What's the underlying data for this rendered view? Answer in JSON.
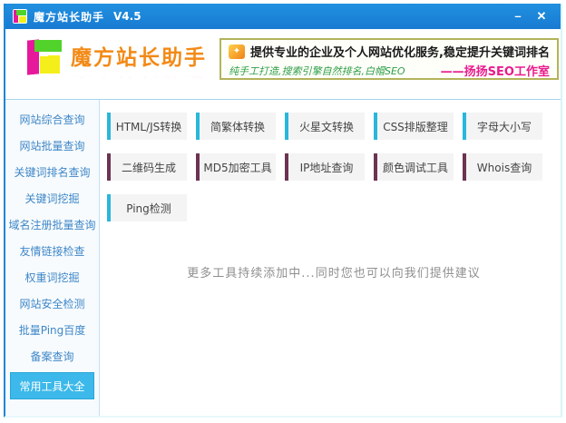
{
  "window": {
    "title": "魔方站长助手",
    "version": "V4.5",
    "minimize_label": "–",
    "close_label": "✕"
  },
  "header": {
    "logo_text": "魔方站长助手",
    "banner": {
      "icon": "seo-ad-icon",
      "line1": "提供专业的企业及个人网站优化服务,稳定提升关键词排名",
      "line2_left": "纯手工打造,搜索引擎自然排名,白帽SEO",
      "line2_right": "——扬扬SEO工作室"
    }
  },
  "sidebar": {
    "items": [
      "网站综合查询",
      "网站批量查询",
      "关键词排名查询",
      "关键词挖掘",
      "域名注册批量查询",
      "友情链接检查",
      "权重词挖掘",
      "网站安全检测",
      "批量Ping百度",
      "备案查询",
      "常用工具大全"
    ],
    "active_item": "常用工具大全"
  },
  "main": {
    "tool_rows": [
      {
        "accent": "#29b7dc",
        "tools": [
          "HTML/JS转换",
          "简繁体转换",
          "火星文转换",
          "CSS排版整理",
          "字母大小写"
        ]
      },
      {
        "accent": "#6c3352",
        "tools": [
          "二维码生成",
          "MD5加密工具",
          "IP地址查询",
          "颜色调试工具",
          "Whois查询"
        ]
      },
      {
        "accent": "#29b7dc",
        "tools": [
          "Ping检测"
        ]
      }
    ],
    "notice": "更多工具持续添加中...同时您也可以向我们提供建议"
  },
  "colors": {
    "titlebar_blue": "#1d82d9",
    "active_sidebar": "#3cb9ea",
    "accent_cyan": "#29b7dc",
    "accent_purple": "#6c3352",
    "logo_orange": "#f28a17",
    "banner_border": "#b3b35c",
    "banner_green": "#2e9e46",
    "banner_magenta": "#e81c8e"
  }
}
